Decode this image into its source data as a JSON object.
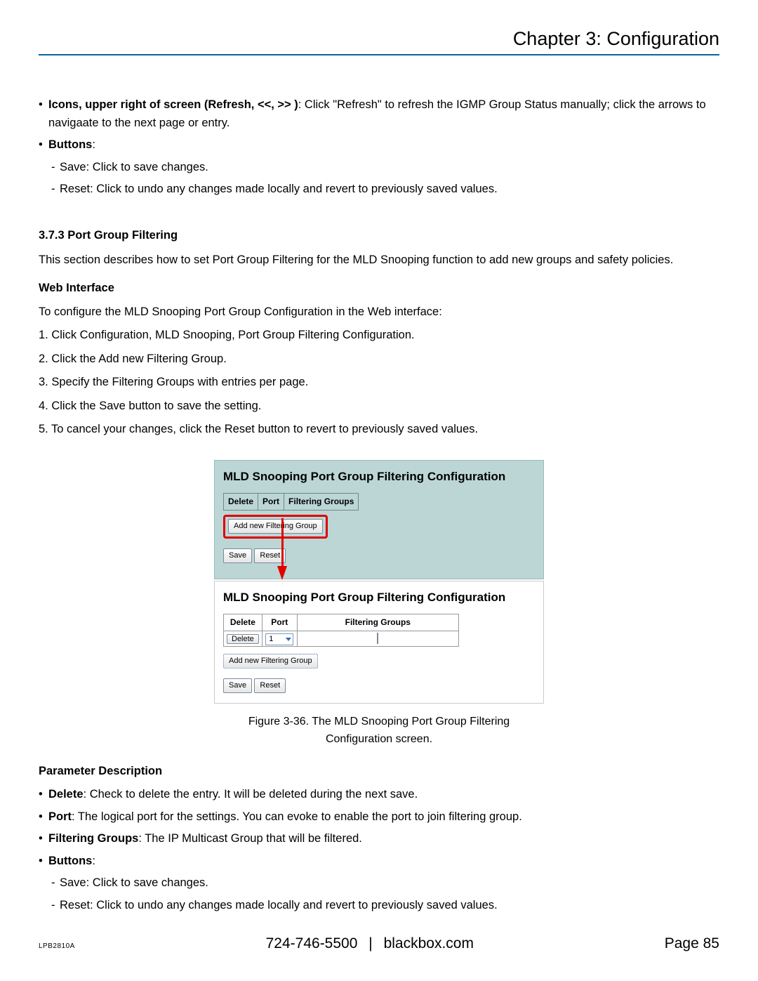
{
  "header": {
    "chapter": "Chapter 3: Configuration"
  },
  "top_bullets": {
    "icons_label": "Icons, upper right of screen (Refresh, <<, >> )",
    "icons_text": ": Click \"Refresh\" to refresh the IGMP Group Status manually; click the arrows to navigaate to the next page or entry.",
    "buttons_label": "Buttons",
    "buttons_colon": ":",
    "save_sub": "Save: Click to save changes.",
    "reset_sub": "Reset: Click to undo any changes made locally and revert to previously saved values."
  },
  "section": {
    "number_title": "3.7.3 Port Group Filtering",
    "intro": "This section describes how to set Port Group Filtering for the MLD Snooping function to add new groups and safety policies.",
    "web_iface": "Web Interface",
    "web_intro": "To configure the MLD Snooping Port Group Configuration in the Web interface:",
    "steps": [
      "1. Click Configuration, MLD Snooping, Port Group Filtering Configuration.",
      "2. Click the Add new Filtering Group.",
      "3. Specify the Filtering Groups with entries per page.",
      "4. Click the Save button to save the setting.",
      "5. To cancel your changes, click the Reset button to revert to previously saved values."
    ]
  },
  "figure": {
    "panel_title": "MLD Snooping Port Group Filtering Configuration",
    "col_delete": "Delete",
    "col_port": "Port",
    "col_fg": "Filtering Groups",
    "btn_add": "Add new Filtering Group",
    "btn_save": "Save",
    "btn_reset": "Reset",
    "btn_delete": "Delete",
    "port_value": "1",
    "caption": "Figure 3-36. The MLD Snooping Port Group Filtering Configuration screen."
  },
  "param": {
    "heading": "Parameter Description",
    "delete_label": "Delete",
    "delete_text": ": Check to delete the entry. It will be deleted during the next save.",
    "port_label": "Port",
    "port_text": ": The logical port for the settings. You can evoke to enable the port to join filtering group.",
    "fg_label": "Filtering Groups",
    "fg_text": ": The IP Multicast Group that will be filtered.",
    "buttons_label": "Buttons",
    "buttons_colon": ":",
    "save_sub": "Save: Click to save changes.",
    "reset_sub": "Reset: Click to undo any changes made locally and revert to previously saved values."
  },
  "footer": {
    "model": "LPB2810A",
    "phone": "724-746-5500",
    "sep": "|",
    "site": "blackbox.com",
    "page": "Page 85"
  }
}
